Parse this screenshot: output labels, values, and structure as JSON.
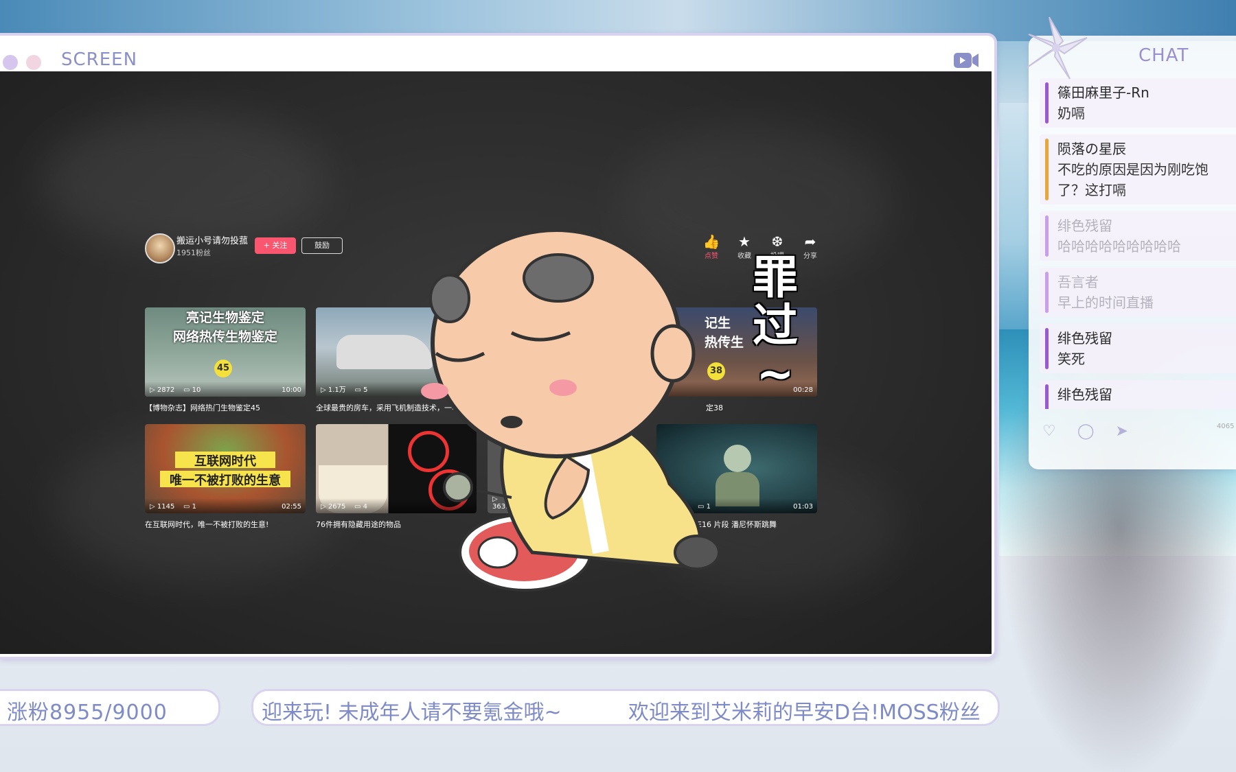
{
  "screen": {
    "title": "SCREEN"
  },
  "uploader": {
    "name": "搬运小号请勿投菰",
    "fans": "1951粉丝",
    "follow_label": "+ 关注",
    "cheer_label": "鼓励"
  },
  "actions": [
    {
      "label": "点赞"
    },
    {
      "label": "收藏"
    },
    {
      "label": "投喂"
    },
    {
      "label": "分享"
    }
  ],
  "videos": [
    {
      "thumb_text_1": "亮记生物鉴定",
      "thumb_text_2": "网络热传生物鉴定",
      "badge": "45",
      "plays": "2872",
      "comments": "10",
      "duration": "10:00",
      "title": "【博物杂志】网络热门生物鉴定45"
    },
    {
      "plays": "1.1万",
      "comments": "5",
      "duration": "",
      "title": "全球最贵的房车，采用飞机制造技术，一年"
    },
    {
      "thumb_text_1": "记生",
      "thumb_text_2": "热传生",
      "badge": "38",
      "duration": "00:28",
      "title": "定38"
    },
    {
      "thumb_text_1": "互联网时代",
      "thumb_text_2": "唯一不被打败的生意",
      "plays": "1145",
      "comments": "1",
      "duration": "02:55",
      "title": "在互联网时代，唯一不被打败的生意!"
    },
    {
      "plays": "2675",
      "comments": "4",
      "duration": "",
      "title": "76件拥有隐藏用途的物品"
    },
    {
      "plays": "3631",
      "comments": "",
      "duration": "",
      "title": ""
    },
    {
      "comments": "1",
      "duration": "01:03",
      "title": "0E16 片段 潘尼怀斯跳舞"
    }
  ],
  "sticker": {
    "text_1": "罪",
    "text_2": "过",
    "text_3": "~"
  },
  "chat": {
    "title": "CHAT",
    "messages": [
      {
        "user": "篠田麻里子-Rn",
        "text": "奶嗝",
        "bar": "#9b59d0"
      },
      {
        "user": "陨落の星辰",
        "text": "不吃的原因是因为刚吃饱",
        "text2": "了？这打嗝",
        "bar": "#e8a53a"
      },
      {
        "user": "绯色残留",
        "text": "哈哈哈哈哈哈哈哈哈",
        "bar": "#c7a0e8"
      },
      {
        "user": "吾言者",
        "text": "早上的时间直播",
        "bar": "#c7a0e8"
      },
      {
        "user": "绯色残留",
        "text": "笑死",
        "bar": "#9b59d0"
      },
      {
        "user": "绯色残留",
        "text": "? ? ?",
        "bar": "#9b59d0"
      }
    ],
    "count": "4065"
  },
  "bottom": {
    "fans_text": "涨粉8955/9000",
    "marquee_1": "迎来玩! 未成年人请不要氪金哦~",
    "marquee_2": "欢迎来到艾米莉的早安D台!MOSS粉丝"
  },
  "colors": {
    "accent": "#8b8fc9",
    "border": "#d9d3ef",
    "follow": "#fb5670"
  }
}
